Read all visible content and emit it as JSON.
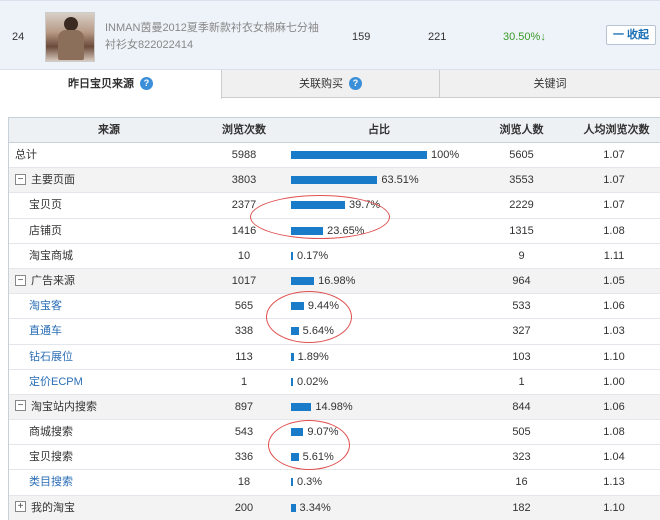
{
  "product": {
    "rank": "24",
    "title": "INMAN茵曼2012夏季新款衬衣女棉麻七分袖衬衫女822022414",
    "val1": "159",
    "val2": "221",
    "val3": "30.50%",
    "val3_arrow": "↓",
    "collapse_label": "一 收起"
  },
  "tabs": [
    {
      "label": "昨日宝贝来源",
      "help": "?",
      "active": true
    },
    {
      "label": "关联购买",
      "help": "?",
      "active": false
    },
    {
      "label": "关键词",
      "help": "",
      "active": false
    }
  ],
  "table": {
    "headers": {
      "source": "来源",
      "views": "浏览次数",
      "share": "占比",
      "visitors": "浏览人数",
      "avg": "人均浏览次数"
    },
    "rows": [
      {
        "source": "总计",
        "views": "5988",
        "share": "100%",
        "share_value": 100,
        "visitors": "5605",
        "avg": "1.07",
        "kind": "total"
      },
      {
        "source": "主要页面",
        "views": "3803",
        "share": "63.51%",
        "share_value": 63.51,
        "visitors": "3553",
        "avg": "1.07",
        "kind": "group",
        "toggle": "−"
      },
      {
        "source": "宝贝页",
        "views": "2377",
        "share": "39.7%",
        "share_value": 39.7,
        "visitors": "2229",
        "avg": "1.07",
        "kind": "child"
      },
      {
        "source": "店铺页",
        "views": "1416",
        "share": "23.65%",
        "share_value": 23.65,
        "visitors": "1315",
        "avg": "1.08",
        "kind": "child"
      },
      {
        "source": "淘宝商城",
        "views": "10",
        "share": "0.17%",
        "share_value": 0.17,
        "visitors": "9",
        "avg": "1.11",
        "kind": "child"
      },
      {
        "source": "广告来源",
        "views": "1017",
        "share": "16.98%",
        "share_value": 16.98,
        "visitors": "964",
        "avg": "1.05",
        "kind": "group",
        "toggle": "−"
      },
      {
        "source": "淘宝客",
        "views": "565",
        "share": "9.44%",
        "share_value": 9.44,
        "visitors": "533",
        "avg": "1.06",
        "kind": "child-link"
      },
      {
        "source": "直通车",
        "views": "338",
        "share": "5.64%",
        "share_value": 5.64,
        "visitors": "327",
        "avg": "1.03",
        "kind": "child-link"
      },
      {
        "source": "钻石展位",
        "views": "113",
        "share": "1.89%",
        "share_value": 1.89,
        "visitors": "103",
        "avg": "1.10",
        "kind": "child-link"
      },
      {
        "source": "定价ECPM",
        "views": "1",
        "share": "0.02%",
        "share_value": 0.02,
        "visitors": "1",
        "avg": "1.00",
        "kind": "child-link"
      },
      {
        "source": "淘宝站内搜索",
        "views": "897",
        "share": "14.98%",
        "share_value": 14.98,
        "visitors": "844",
        "avg": "1.06",
        "kind": "group",
        "toggle": "−"
      },
      {
        "source": "商城搜索",
        "views": "543",
        "share": "9.07%",
        "share_value": 9.07,
        "visitors": "505",
        "avg": "1.08",
        "kind": "child"
      },
      {
        "source": "宝贝搜索",
        "views": "336",
        "share": "5.61%",
        "share_value": 5.61,
        "visitors": "323",
        "avg": "1.04",
        "kind": "child"
      },
      {
        "source": "类目搜索",
        "views": "18",
        "share": "0.3%",
        "share_value": 0.3,
        "visitors": "16",
        "avg": "1.13",
        "kind": "child-link"
      },
      {
        "source": "我的淘宝",
        "views": "200",
        "share": "3.34%",
        "share_value": 3.34,
        "visitors": "182",
        "avg": "1.10",
        "kind": "collapsed",
        "toggle": "+"
      }
    ]
  },
  "colors": {
    "bar": "#1a7bc8",
    "annotation": "#e05050",
    "link": "#2a6db5",
    "positive": "#3a9a2a"
  }
}
